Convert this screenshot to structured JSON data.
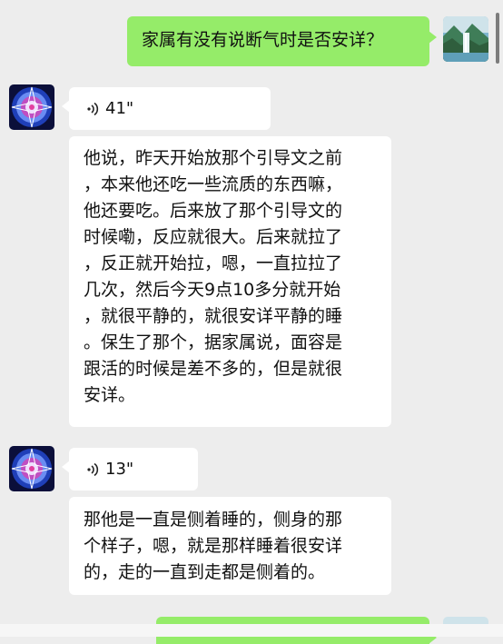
{
  "messages": [
    {
      "direction": "out",
      "type": "text",
      "text": "家属有没有说断气时是否安详？"
    },
    {
      "direction": "in",
      "type": "voice",
      "duration": "41\""
    },
    {
      "direction": "in",
      "type": "transcript",
      "lines": [
        "他说，昨天开始放那个引导文之前",
        "，本来他还吃一些流质的东西嘛，",
        "他还要吃。后来放了那个引导文的",
        "时候嘞，反应就很大。后来就拉了",
        "，反正就开始拉，嗯，一直拉拉了",
        "几次，然后今天9点10多分就开始",
        "，就很平静的，就很安详平静的睡",
        "。保生了那个，据家属说，面容是",
        "跟活的时候是差不多的，但是就很",
        "安详。"
      ]
    },
    {
      "direction": "in",
      "type": "voice",
      "duration": "13\""
    },
    {
      "direction": "in",
      "type": "transcript",
      "lines": [
        "那他是一直是侧着睡的，侧身的那",
        "个样子，嗯，就是那样睡着很安详",
        "的，走的一直到走都是侧着的。"
      ]
    }
  ],
  "icons": {
    "voice": "voice-wave-icon",
    "self_avatar": "landscape-waterfall-avatar",
    "contact_avatar": "mandala-avatar"
  },
  "colors": {
    "outgoing_bubble": "#95ec69",
    "incoming_bubble": "#ffffff",
    "background": "#ededed"
  }
}
